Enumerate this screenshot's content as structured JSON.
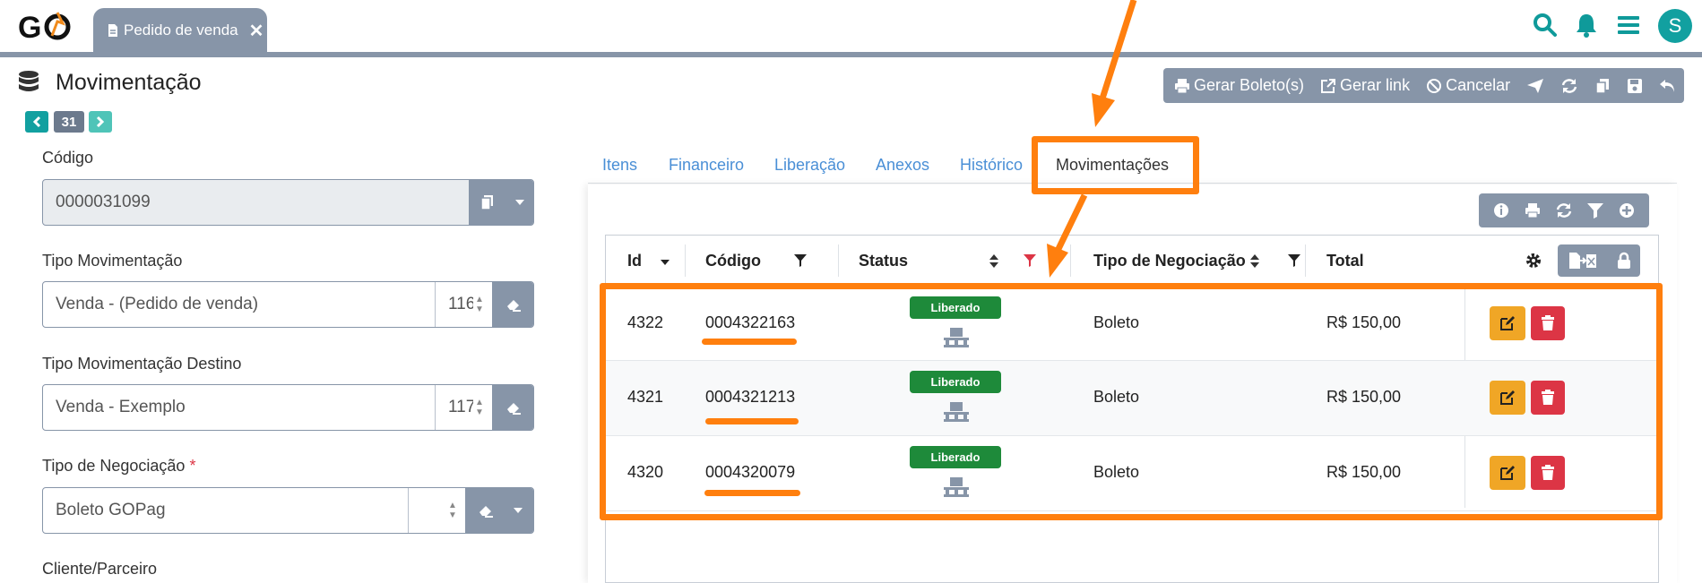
{
  "topbar": {
    "logo": "GO",
    "doc_tab_label": "Pedido de venda",
    "avatar_letter": "S"
  },
  "header": {
    "title": "Movimentação",
    "record_number": "31"
  },
  "actions": {
    "gerar_boleto": "Gerar Boleto(s)",
    "gerar_link": "Gerar link",
    "cancelar": "Cancelar"
  },
  "form": {
    "codigo": {
      "label": "Código",
      "value": "0000031099"
    },
    "tipo_movimentacao": {
      "label": "Tipo Movimentação",
      "value": "Venda - (Pedido de venda)",
      "number": "116"
    },
    "tipo_movimentacao_destino": {
      "label": "Tipo Movimentação Destino",
      "value": "Venda - Exemplo",
      "number": "117"
    },
    "tipo_negociacao": {
      "label": "Tipo de Negociação",
      "required_mark": "*",
      "value": "Boleto GOPag"
    },
    "cliente_parceiro": {
      "label": "Cliente/Parceiro"
    }
  },
  "tabs": [
    {
      "label": "Itens"
    },
    {
      "label": "Financeiro"
    },
    {
      "label": "Liberação"
    },
    {
      "label": "Anexos"
    },
    {
      "label": "Histórico"
    },
    {
      "label": "Movimentações",
      "active": true
    }
  ],
  "grid": {
    "columns": [
      "Id",
      "Código",
      "Status",
      "Tipo de Negociação",
      "Total"
    ],
    "rows": [
      {
        "id": "4322",
        "codigo": "0004322163",
        "status": "Liberado",
        "tipo": "Boleto",
        "total": "R$ 150,00"
      },
      {
        "id": "4321",
        "codigo": "0004321213",
        "status": "Liberado",
        "tipo": "Boleto",
        "total": "R$ 150,00"
      },
      {
        "id": "4320",
        "codigo": "0004320079",
        "status": "Liberado",
        "tipo": "Boleto",
        "total": "R$ 150,00"
      }
    ]
  },
  "colors": {
    "accent": "#12a0a0",
    "toolbar": "#8795a8",
    "annotation": "#ff7f0e",
    "badge_success": "#1e8a3a",
    "edit": "#f0a626",
    "delete": "#dc3545",
    "link": "#4a8fd6"
  },
  "icons": [
    "search-icon",
    "bell-icon",
    "menu-icon",
    "database-icon",
    "file-icon",
    "close-icon",
    "print-icon",
    "external-link-icon",
    "ban-icon",
    "send-icon",
    "refresh-icon",
    "copy-icon",
    "save-icon",
    "undo-icon",
    "info-icon",
    "filter-icon",
    "plus-circle-icon",
    "gear-icon",
    "lock-icon",
    "edit-icon",
    "trash-icon",
    "pallet-icon",
    "eraser-icon",
    "caret-down-icon"
  ]
}
